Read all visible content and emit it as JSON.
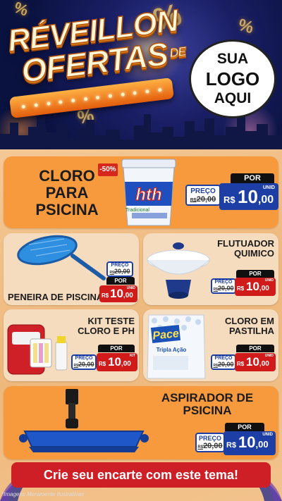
{
  "header": {
    "headline_line1": "RÉVEILLON",
    "headline_line2": "OFERTAS",
    "headline_de": "DE",
    "logo_line1": "SUA",
    "logo_line2": "LOGO",
    "logo_line3": "AQUI"
  },
  "colors": {
    "brand_orange": "#f79a3e",
    "price_blue": "#1d3fa5",
    "price_red": "#d11a1a",
    "banner_red": "#cf1f26"
  },
  "products": [
    {
      "name_lines": [
        "CLORO",
        "PARA",
        "PSICINA"
      ],
      "discount": "-50%",
      "brand": "hth",
      "brand_sub": "Tradicional",
      "por": "POR",
      "old_label": "PREÇO",
      "old_cur": "R$",
      "old_value": "20,00",
      "new_cur": "R$",
      "new_int": "10",
      "new_dec": ",00",
      "unit": "UNID",
      "icon": "chlorine-bucket-icon"
    },
    {
      "name": "PENEIRA DE PISCINA",
      "por": "POR",
      "old_label": "PREÇO",
      "old_cur": "R$",
      "old_value": "20,00",
      "new_cur": "R$",
      "new_int": "10",
      "new_dec": ",00",
      "unit": "UNID",
      "icon": "pool-skimmer-net-icon"
    },
    {
      "name_lines": [
        "FLUTUADOR",
        "QUIMICO"
      ],
      "por": "POR",
      "old_label": "PREÇO",
      "old_cur": "R$",
      "old_value": "20,00",
      "new_cur": "R$",
      "new_int": "10",
      "new_dec": ",00",
      "unit": "UNID",
      "icon": "chemical-floater-icon"
    },
    {
      "name_lines": [
        "KIT TESTE",
        "CLORO E PH"
      ],
      "por": "POR",
      "old_label": "PREÇO",
      "old_cur": "R$",
      "old_value": "20,00",
      "new_cur": "R$",
      "new_int": "10",
      "new_dec": ",00",
      "unit": "KIT",
      "icon": "test-kit-icon"
    },
    {
      "name_lines": [
        "CLORO EM",
        "PASTILHA"
      ],
      "brand": "Pace",
      "brand_sub": "Tripla Ação",
      "por": "POR",
      "old_label": "PREÇO",
      "old_cur": "R$",
      "old_value": "20,00",
      "new_cur": "R$",
      "new_int": "10",
      "new_dec": ",00",
      "unit": "UNID",
      "icon": "chlorine-tablet-bag-icon"
    },
    {
      "name_lines": [
        "ASPIRADOR DE",
        "PSICINA"
      ],
      "por": "POR",
      "old_label": "PREÇO",
      "old_cur": "R$",
      "old_value": "20,00",
      "new_cur": "R$",
      "new_int": "10",
      "new_dec": ",00",
      "unit": "UNID",
      "icon": "pool-vacuum-head-icon"
    }
  ],
  "banner": {
    "cta": "Crie seu encarte com este tema!"
  },
  "footer": {
    "note": "*Imagens Meramente Ilustrativas"
  }
}
